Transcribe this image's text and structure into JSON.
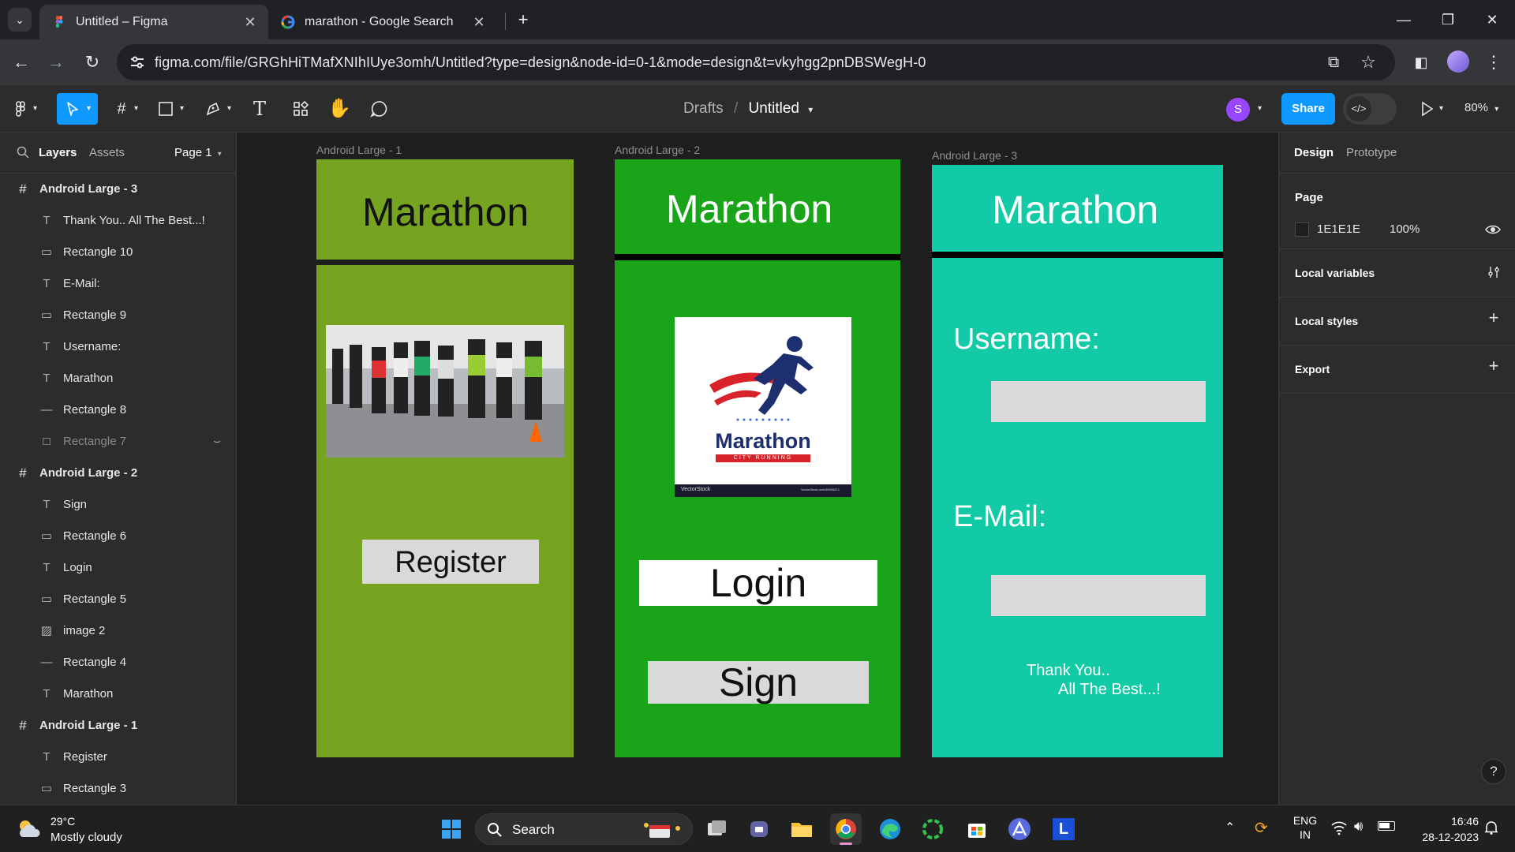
{
  "browser": {
    "tabs": [
      {
        "title": "Untitled – Figma",
        "active": true
      },
      {
        "title": "marathon - Google Search",
        "active": false
      }
    ],
    "url": "figma.com/file/GRGhHiTMafXNIhIUye3omh/Untitled?type=design&node-id=0-1&mode=design&t=vkyhgg2pnDBSWegH-0"
  },
  "figma": {
    "breadcrumb_root": "Drafts",
    "breadcrumb_sep": "/",
    "file_name": "Untitled",
    "avatar_initial": "S",
    "share_label": "Share",
    "zoom": "80%",
    "left_tabs": {
      "layers": "Layers",
      "assets": "Assets",
      "page": "Page 1"
    },
    "layers": [
      {
        "name": "Android Large - 3",
        "type": "frame"
      },
      {
        "name": "Thank You.. All The Best...!",
        "type": "text"
      },
      {
        "name": "Rectangle 10",
        "type": "rect"
      },
      {
        "name": "E-Mail:",
        "type": "text"
      },
      {
        "name": "Rectangle 9",
        "type": "rect"
      },
      {
        "name": "Username:",
        "type": "text"
      },
      {
        "name": "Marathon",
        "type": "text"
      },
      {
        "name": "Rectangle 8",
        "type": "line"
      },
      {
        "name": "Rectangle 7",
        "type": "hidden"
      },
      {
        "name": "Android Large - 2",
        "type": "frame"
      },
      {
        "name": "Sign",
        "type": "text"
      },
      {
        "name": "Rectangle 6",
        "type": "rect"
      },
      {
        "name": "Login",
        "type": "text"
      },
      {
        "name": "Rectangle 5",
        "type": "rect"
      },
      {
        "name": "image 2",
        "type": "image"
      },
      {
        "name": "Rectangle 4",
        "type": "line"
      },
      {
        "name": "Marathon",
        "type": "text"
      },
      {
        "name": "Android Large - 1",
        "type": "frame"
      },
      {
        "name": "Register",
        "type": "text"
      },
      {
        "name": "Rectangle 3",
        "type": "rect"
      }
    ],
    "frames": {
      "f1": {
        "label": "Android Large - 1",
        "title": "Marathon",
        "button": "Register",
        "color": "#76a420"
      },
      "f2": {
        "label": "Android Large - 2",
        "title": "Marathon",
        "logo_text": "Marathon",
        "logo_sub": "CITY RUNNING",
        "logo_foot_left": "VectorStock",
        "logo_foot_right": "VectorStock.com/35900871",
        "login": "Login",
        "sign": "Sign",
        "color": "#1aa41a"
      },
      "f3": {
        "label": "Android Large - 3",
        "title": "Marathon",
        "username": "Username:",
        "email": "E-Mail:",
        "thanks_1": "Thank You..",
        "thanks_2": "All The Best...!",
        "color": "#12cba6"
      }
    },
    "right": {
      "tabs": {
        "design": "Design",
        "prototype": "Prototype"
      },
      "page_label": "Page",
      "page_color": "1E1E1E",
      "page_opacity": "100%",
      "local_variables": "Local variables",
      "local_styles": "Local styles",
      "export": "Export"
    }
  },
  "taskbar": {
    "weather_temp": "29°C",
    "weather_desc": "Mostly cloudy",
    "search": "Search",
    "lang_1": "ENG",
    "lang_2": "IN",
    "time": "16:46",
    "date": "28-12-2023",
    "l_app": "L"
  }
}
